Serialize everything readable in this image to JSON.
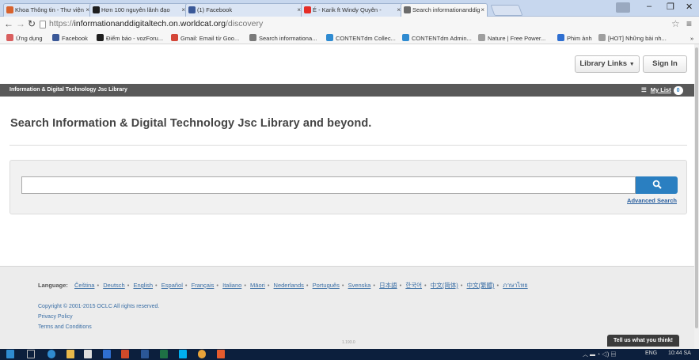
{
  "browser": {
    "tabs": [
      {
        "title": "Khoa Thông tin - Thư viện",
        "color": "#d8622d"
      },
      {
        "title": "Hơn 100 nguyên lãnh đạo",
        "color": "#1e1e1e"
      },
      {
        "title": "(1) Facebook",
        "color": "#3b5998"
      },
      {
        "title": "É - Karik ft Windy Quyên -",
        "color": "#e52d27"
      },
      {
        "title": "Search informationanddig",
        "color": "#6b6b6b"
      }
    ],
    "close_glyph": "×",
    "url_scheme": "https://",
    "url_domain": "informationanddigitaltech.on.worldcat.org",
    "url_path": "/discovery",
    "bookmarks": [
      {
        "label": "Ứng dụng",
        "color": "#d95f5f"
      },
      {
        "label": "Facebook",
        "color": "#3b5998"
      },
      {
        "label": "Điểm báo - vozForu...",
        "color": "#1e1e1e"
      },
      {
        "label": "Gmail: Email từ Goo...",
        "color": "#d44638"
      },
      {
        "label": "Search informationa...",
        "color": "#7a7a7a"
      },
      {
        "label": "CONTENTdm Collec...",
        "color": "#2f8bd1"
      },
      {
        "label": "CONTENTdm Admin...",
        "color": "#2f8bd1"
      },
      {
        "label": "Nature | Free Power...",
        "color": "#9e9e9e"
      },
      {
        "label": "Phim ảnh",
        "color": "#2f6fd1"
      },
      {
        "label": "[HOT] Những bài nh...",
        "color": "#9e9e9e"
      }
    ],
    "overflow_glyph": "»"
  },
  "header": {
    "library_links": "Library Links",
    "sign_in": "Sign In",
    "library_name": "Information & Digital Technology Jsc Library",
    "my_list": "My List",
    "my_list_count": "0"
  },
  "main": {
    "headline": "Search Information & Digital Technology Jsc Library and beyond.",
    "search_placeholder": "",
    "advanced_search": "Advanced Search"
  },
  "footer": {
    "language_label": "Language:",
    "languages": [
      "Čeština",
      "Deutsch",
      "English",
      "Español",
      "Français",
      "Italiano",
      "Māori",
      "Nederlands",
      "Português",
      "Svenska",
      "日本語",
      "한국어",
      "中文(简体)",
      "中文(繁體)",
      "ภาษาไทย"
    ],
    "copyright": "Copyright © 2001-2015 OCLC All rights reserved.",
    "privacy": "Privacy Policy",
    "terms": "Terms and Conditions",
    "version": "1.193.0",
    "feedback": "Tell us what you think!"
  },
  "taskbar": {
    "language": "ENG",
    "time": "10:44 SA"
  },
  "colors": {
    "accent": "#2a7fc1",
    "library_bar": "#595959",
    "link": "#3a6ea5"
  }
}
